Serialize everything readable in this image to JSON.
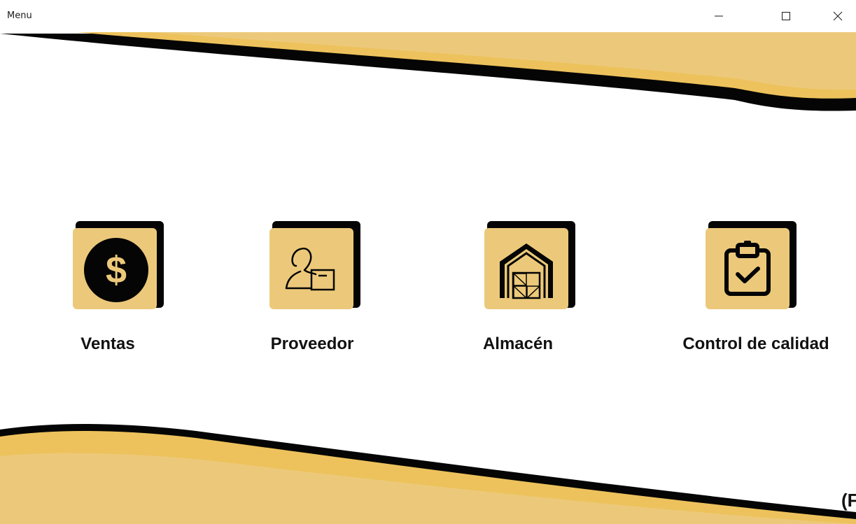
{
  "window": {
    "title": "Menu",
    "controls": {
      "minimize_icon": "minimize-icon",
      "maximize_icon": "maximize-icon",
      "close_icon": "close-icon"
    }
  },
  "menu": {
    "items": [
      {
        "label": "Ventas",
        "icon": "dollar-icon"
      },
      {
        "label": "Proveedor",
        "icon": "supplier-icon"
      },
      {
        "label": "Almacén",
        "icon": "warehouse-icon"
      },
      {
        "label": "Control de calidad",
        "icon": "clipboard-check-icon"
      }
    ]
  },
  "footer": {
    "corner_text": "(F"
  },
  "colors": {
    "gold_light": "#ecc97a",
    "gold_mid": "#edc25c",
    "black": "#050505",
    "background": "#ffffff"
  }
}
